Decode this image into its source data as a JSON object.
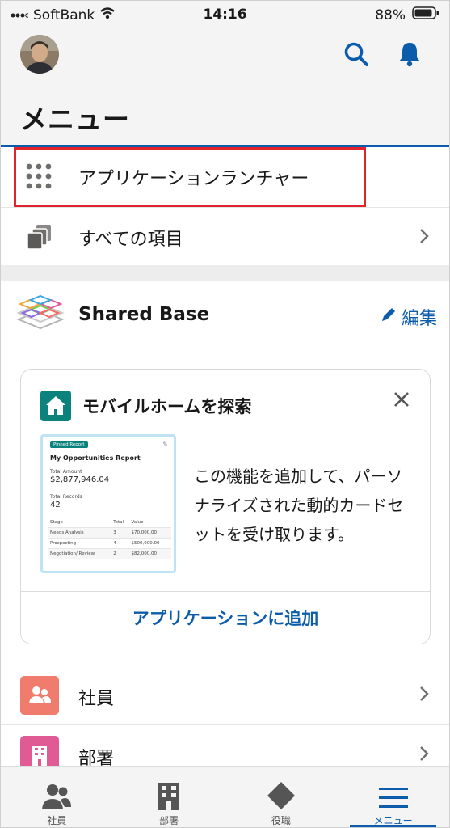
{
  "status_bar": {
    "carrier": "SoftBank",
    "time": "14:16",
    "battery": "88%"
  },
  "header": {
    "title": "メニュー"
  },
  "nav": {
    "launcher_label": "アプリケーションランチャー",
    "all_items_label": "すべての項目"
  },
  "app": {
    "name": "Shared Base",
    "edit_label": "編集"
  },
  "promo_card": {
    "title": "モバイルホームを探索",
    "description": "この機能を追加して、パーソナライズされた動的カードセットを受け取ります。",
    "add_label": "アプリケーションに追加",
    "preview": {
      "pill": "Pinned Report",
      "report_title": "My Opportunities Report",
      "amount_label": "Total Amount",
      "amount": "$2,877,946.04",
      "records_label": "Total Records",
      "records": "42",
      "columns": [
        "Stage",
        "Total",
        "Value"
      ],
      "rows": [
        [
          "Needs Analysis",
          "3",
          "$70,000.00"
        ],
        [
          "Prospecting",
          "4",
          "$500,000.00"
        ],
        [
          "Negotiation/ Review",
          "2",
          "$82,000.00"
        ]
      ]
    }
  },
  "list": [
    {
      "label": "社員",
      "color": "#ef7c6c",
      "icon": "people-icon"
    },
    {
      "label": "部署",
      "color": "#e05a93",
      "icon": "building-icon"
    }
  ],
  "tabbar": [
    {
      "label": "社員",
      "icon": "people-icon"
    },
    {
      "label": "部署",
      "icon": "building-icon"
    },
    {
      "label": "役職",
      "icon": "diamond-icon"
    },
    {
      "label": "メニュー",
      "icon": "hamburger-icon",
      "active": true
    }
  ],
  "colors": {
    "accent": "#0b5cab",
    "highlight": "#e1232b"
  }
}
